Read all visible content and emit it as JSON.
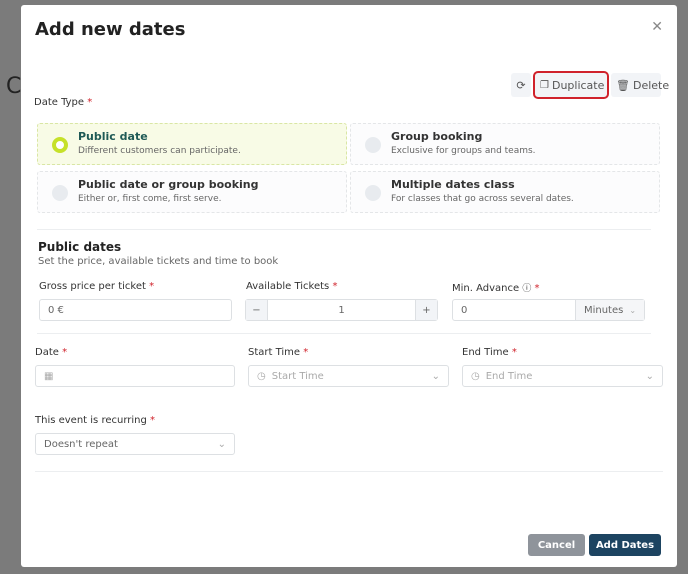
{
  "background": {
    "letter": "C"
  },
  "modal": {
    "title": "Add new dates",
    "toolbar": {
      "duplicate": "Duplicate",
      "delete": "Delete"
    },
    "date_type_label": "Date Type",
    "date_types": [
      {
        "title": "Public date",
        "subtitle": "Different customers can participate.",
        "selected": true
      },
      {
        "title": "Group booking",
        "subtitle": "Exclusive for groups and teams.",
        "selected": false
      },
      {
        "title": "Public date or group booking",
        "subtitle": "Either or, first come, first serve.",
        "selected": false
      },
      {
        "title": "Multiple dates class",
        "subtitle": "For classes that go across several dates.",
        "selected": false
      }
    ],
    "section_title": "Public dates",
    "section_subtitle": "Set the price, available tickets and time to book",
    "price_label": "Gross price per ticket",
    "price_value": "0 €",
    "tickets_label": "Available Tickets",
    "tickets_value": "1",
    "advance_label": "Min. Advance",
    "advance_value": "0",
    "advance_unit": "Minutes",
    "date_label": "Date",
    "start_label": "Start Time",
    "start_placeholder": "Start Time",
    "end_label": "End Time",
    "end_placeholder": "End Time",
    "recurring_label": "This event is recurring",
    "recurring_value": "Doesn't repeat",
    "cancel": "Cancel",
    "add": "Add Dates",
    "required_mark": "*"
  },
  "colors": {
    "accent": "#c6e12a",
    "primary": "#1d4461",
    "highlight": "#d0222b"
  }
}
